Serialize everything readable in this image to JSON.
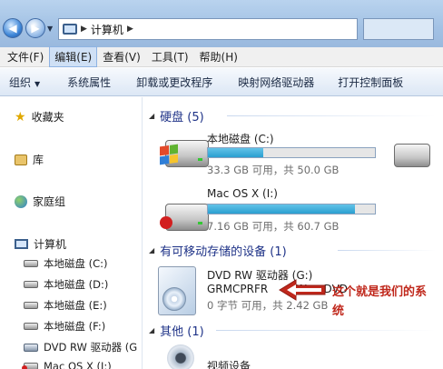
{
  "address": {
    "crumb": "计算机"
  },
  "menu": [
    "文件(F)",
    "编辑(E)",
    "查看(V)",
    "工具(T)",
    "帮助(H)"
  ],
  "toolbar": {
    "organize": "组织",
    "items": [
      "系统属性",
      "卸载或更改程序",
      "映射网络驱动器",
      "打开控制面板"
    ]
  },
  "nav": {
    "favorites": "收藏夹",
    "libraries": "库",
    "homegroup": "家庭组",
    "computer": "计算机",
    "drives": [
      "本地磁盘 (C:)",
      "本地磁盘 (D:)",
      "本地磁盘 (E:)",
      "本地磁盘 (F:)",
      "DVD RW 驱动器 (G",
      "Mac OS X (I:)"
    ]
  },
  "groups": {
    "hdd": "硬盘 (5)",
    "removable": "有可移动存储的设备 (1)",
    "other": "其他 (1)"
  },
  "drive_c": {
    "name": "本地磁盘 (C:)",
    "info": "33.3 GB 可用，共 50.0 GB",
    "used_fraction": 0.334
  },
  "drive_i": {
    "name": "Mac OS X (I:)",
    "info": "7.16 GB 可用，共 60.7 GB",
    "used_fraction": 0.882
  },
  "dvd": {
    "name": "DVD RW 驱动器 (G:)",
    "label": "GRMCPRFR",
    "label_suffix": "CN",
    "label_end": "DVD",
    "info": "0 字节 可用，共 2.42 GB"
  },
  "other_device": {
    "name": "视频设备"
  },
  "annotation": {
    "line1": "这个就是我们的系",
    "line2": "统"
  },
  "colors": {
    "accent": "#1e3287",
    "annotation": "#c0281c",
    "bar_fill": "#2a9fd0"
  }
}
